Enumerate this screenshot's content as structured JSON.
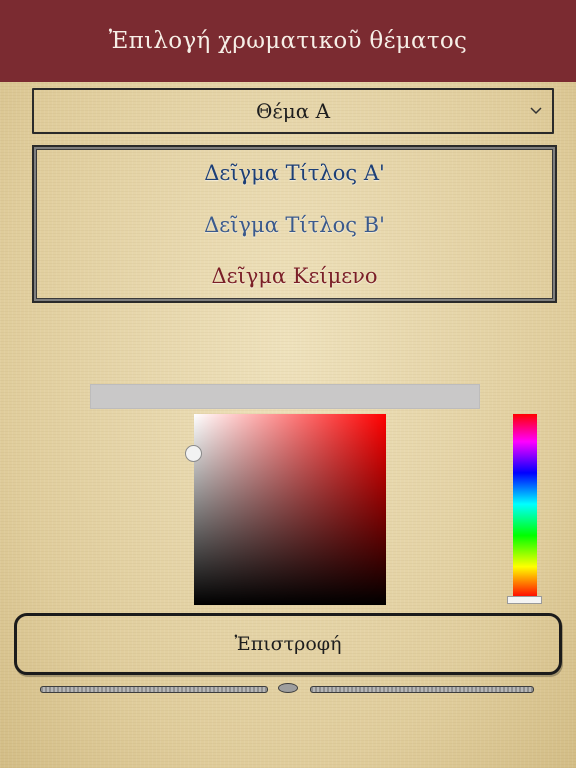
{
  "header": {
    "title": "Ἐπιλογή χρωματικοῦ θέματος"
  },
  "theme_select": {
    "selected": "Θέμα Α",
    "icon": "chevron-down-icon"
  },
  "preview": {
    "title_a": "Δεῖγμα Τίτλος Α'",
    "title_b": "Δεῖγμα Τίτλος Β'",
    "body_text": "Δεῖγμα Κείμενο"
  },
  "colors": {
    "header_background": "#7b2b31",
    "title_a_color": "#1d3f76",
    "title_b_color": "#3b5a8c",
    "body_text_color": "#7b1f26",
    "picker_hue": "#ff0000"
  },
  "color_picker": {
    "hex_value": ""
  },
  "footer": {
    "return_label": "Ἐπιστροφή"
  }
}
